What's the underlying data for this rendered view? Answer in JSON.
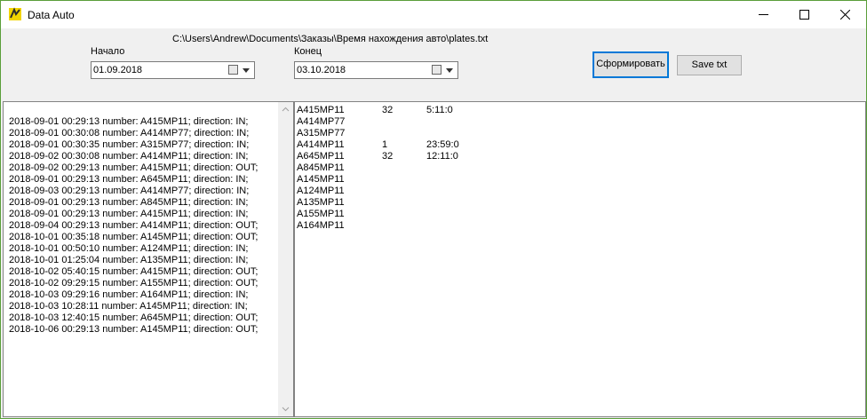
{
  "window": {
    "title": "Data Auto"
  },
  "header": {
    "file_path": "C:\\Users\\Andrew\\Documents\\Заказы\\Время нахождения авто\\plates.txt",
    "start_label": "Начало",
    "start_value": "01.09.2018",
    "end_label": "Конец",
    "end_value": "03.10.2018",
    "generate_label": "Сформировать",
    "save_label": "Save txt"
  },
  "log": [
    "2018-09-01 00:29:13 number: A415MP11; direction: IN;",
    "2018-09-01 00:30:08 number: A414MP77; direction: IN;",
    "2018-09-01 00:30:35 number: A315MP77; direction: IN;",
    "2018-09-02 00:30:08 number: A414MP11; direction: IN;",
    "2018-09-02 00:29:13 number: A415MP11; direction: OUT;",
    "2018-09-01 00:29:13 number: A645MP11; direction: IN;",
    "2018-09-03 00:29:13 number: A414MP77; direction: IN;",
    "2018-09-01 00:29:13 number: A845MP11; direction: IN;",
    "2018-09-01 00:29:13 number: A415MP11; direction: IN;",
    "2018-09-04 00:29:13 number: A414MP11; direction: OUT;",
    "2018-10-01 00:35:18 number: A145MP11; direction: OUT;",
    "2018-10-01 00:50:10 number: A124MP11; direction: IN;",
    "2018-10-01 01:25:04 number: A135MP11; direction: IN;",
    "2018-10-02 05:40:15 number: A415MP11; direction: OUT;",
    "2018-10-02 09:29:15 number: A155MP11; direction: OUT;",
    "2018-10-03 09:29:16 number: A164MP11; direction: IN;",
    "2018-10-03 10:28:11 number: A145MP11; direction: IN;",
    "2018-10-03 12:40:15 number: A645MP11; direction: OUT;",
    "2018-10-06 00:29:13 number: A145MP11; direction: OUT;"
  ],
  "results": [
    {
      "plate": "A415MP11",
      "count": "32",
      "time": "5:11:0"
    },
    {
      "plate": "A414MP77",
      "count": "",
      "time": ""
    },
    {
      "plate": "A315MP77",
      "count": "",
      "time": ""
    },
    {
      "plate": "A414MP11",
      "count": "1",
      "time": "23:59:0"
    },
    {
      "plate": "A645MP11",
      "count": "32",
      "time": "12:11:0"
    },
    {
      "plate": "A845MP11",
      "count": "",
      "time": ""
    },
    {
      "plate": "A145MP11",
      "count": "",
      "time": ""
    },
    {
      "plate": "A124MP11",
      "count": "",
      "time": ""
    },
    {
      "plate": "A135MP11",
      "count": "",
      "time": ""
    },
    {
      "plate": "A155MP11",
      "count": "",
      "time": ""
    },
    {
      "plate": "A164MP11",
      "count": "",
      "time": ""
    }
  ]
}
